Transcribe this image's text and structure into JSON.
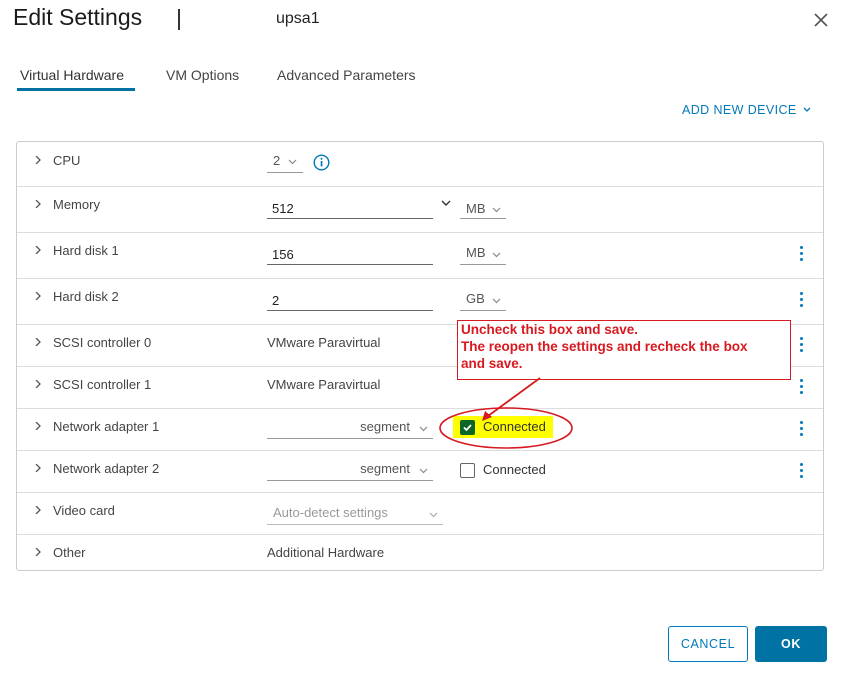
{
  "dialog": {
    "title": "Edit Settings",
    "vm_name": "upsa1",
    "close_icon": "close-icon"
  },
  "tabs": [
    {
      "label": "Virtual Hardware",
      "active": true
    },
    {
      "label": "VM Options",
      "active": false
    },
    {
      "label": "Advanced Parameters",
      "active": false
    }
  ],
  "add_device": {
    "label": "ADD NEW DEVICE"
  },
  "rows": {
    "cpu": {
      "label": "CPU",
      "value": "2"
    },
    "memory": {
      "label": "Memory",
      "value": "512",
      "unit": "MB"
    },
    "disk1": {
      "label": "Hard disk 1",
      "value": "156",
      "unit": "MB"
    },
    "disk2": {
      "label": "Hard disk 2",
      "value": "2",
      "unit": "GB"
    },
    "scsi0": {
      "label": "SCSI controller 0",
      "value": "VMware Paravirtual"
    },
    "scsi1": {
      "label": "SCSI controller 1",
      "value": "VMware Paravirtual"
    },
    "net1": {
      "label": "Network adapter 1",
      "network": "segment",
      "connected_label": "Connected",
      "connected": true
    },
    "net2": {
      "label": "Network adapter 2",
      "network": "segment",
      "connected_label": "Connected",
      "connected": false
    },
    "video": {
      "label": "Video card",
      "value": "Auto-detect settings"
    },
    "other": {
      "label": "Other",
      "value": "Additional Hardware"
    }
  },
  "annotation": {
    "line1": "Uncheck this box and save.",
    "line2": "The reopen the settings and recheck the box",
    "line3": "and save.",
    "color": "#d71920",
    "highlight": "#ffff00"
  },
  "buttons": {
    "cancel": "CANCEL",
    "ok": "OK"
  },
  "colors": {
    "accent": "#0079b8",
    "primary": "#0072a3",
    "check": "#0b6626"
  }
}
